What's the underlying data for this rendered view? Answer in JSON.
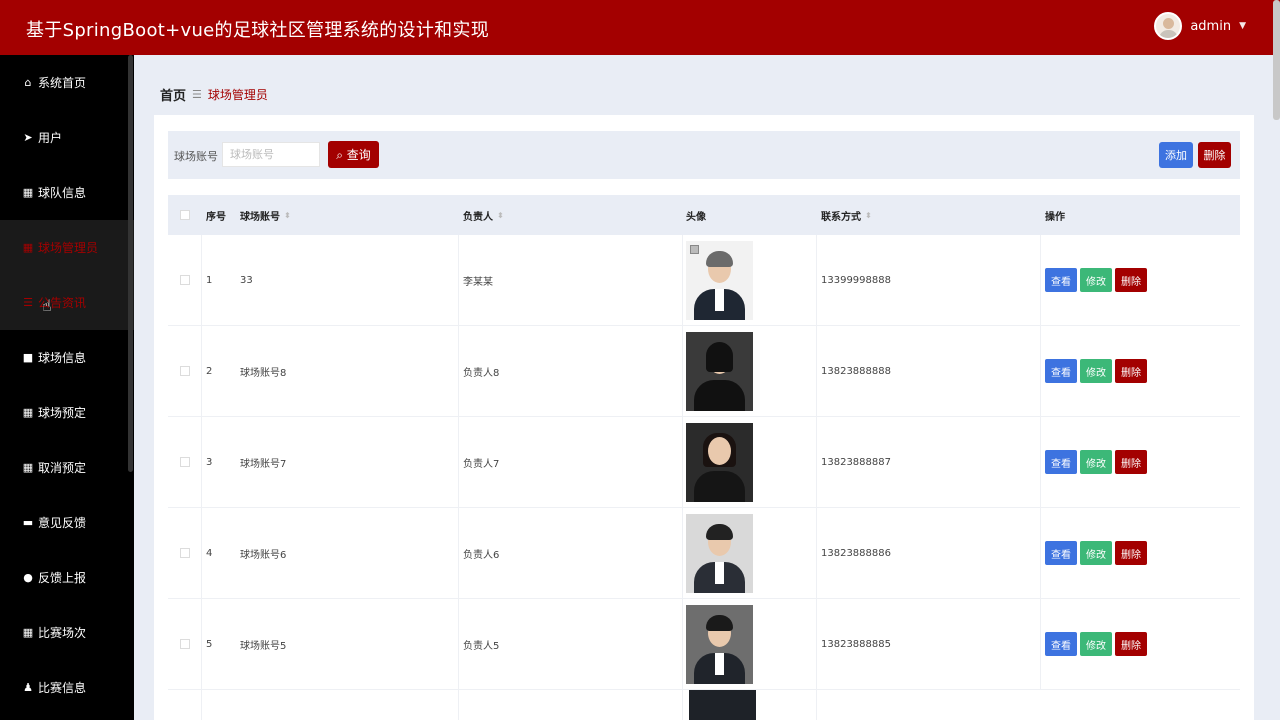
{
  "header": {
    "title": "基于SpringBoot+vue的足球社区管理系统的设计和实现",
    "username": "admin"
  },
  "sidebar": {
    "items": [
      {
        "label": "系统首页",
        "icon": "home-icon",
        "active": false
      },
      {
        "label": "用户",
        "icon": "send-icon",
        "active": false
      },
      {
        "label": "球队信息",
        "icon": "grid-icon",
        "active": false
      },
      {
        "label": "球场管理员",
        "icon": "grid-icon",
        "active": true
      },
      {
        "label": "公告资讯",
        "icon": "list-icon",
        "active": true
      },
      {
        "label": "球场信息",
        "icon": "briefcase-icon",
        "active": false
      },
      {
        "label": "球场预定",
        "icon": "grid-icon",
        "active": false
      },
      {
        "label": "取消预定",
        "icon": "grid-icon",
        "active": false
      },
      {
        "label": "意见反馈",
        "icon": "ticket-icon",
        "active": false
      },
      {
        "label": "反馈上报",
        "icon": "location-icon",
        "active": false
      },
      {
        "label": "比赛场次",
        "icon": "grid-icon",
        "active": false
      },
      {
        "label": "比赛信息",
        "icon": "user-icon",
        "active": false
      }
    ]
  },
  "breadcrumb": {
    "home": "首页",
    "current": "球场管理员"
  },
  "search": {
    "label": "球场账号",
    "placeholder": "球场账号",
    "value": "",
    "query_label": "查询"
  },
  "toolbar": {
    "add_label": "添加",
    "delete_label": "删除"
  },
  "table": {
    "columns": [
      "序号",
      "球场账号",
      "负责人",
      "头像",
      "联系方式",
      "操作"
    ],
    "rows": [
      {
        "idx": "1",
        "account": "33",
        "manager": "李某某",
        "phone": "13399998888"
      },
      {
        "idx": "2",
        "account": "球场账号8",
        "manager": "负责人8",
        "phone": "13823888888"
      },
      {
        "idx": "3",
        "account": "球场账号7",
        "manager": "负责人7",
        "phone": "13823888887"
      },
      {
        "idx": "4",
        "account": "球场账号6",
        "manager": "负责人6",
        "phone": "13823888886"
      },
      {
        "idx": "5",
        "account": "球场账号5",
        "manager": "负责人5",
        "phone": "13823888885"
      }
    ],
    "actions": {
      "view": "查看",
      "edit": "修改",
      "delete": "删除"
    }
  },
  "colors": {
    "primary": "#a30000",
    "sidebar_bg": "#000000",
    "view_button": "#3d73e0",
    "edit_button": "#3cb878"
  }
}
